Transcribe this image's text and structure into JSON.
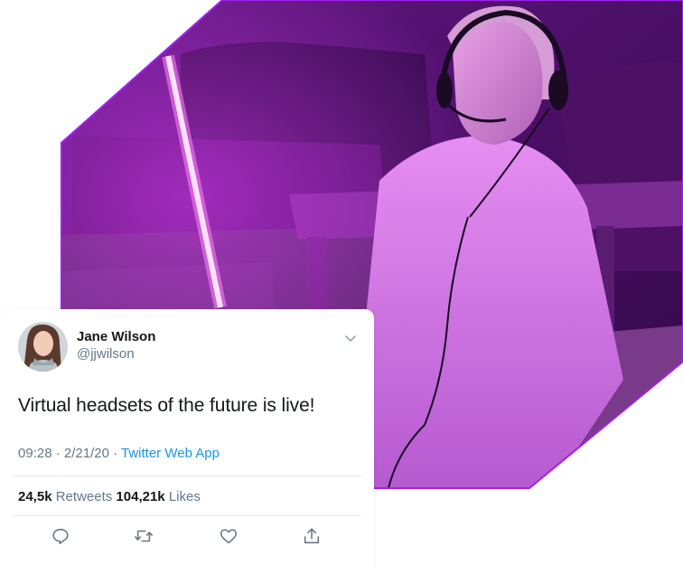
{
  "tweet": {
    "name": "Jane Wilson",
    "handle": "@jjwilson",
    "text": "Virtual headsets of the future is live!",
    "time": "09:28",
    "separator": " · ",
    "date": "2/21/20",
    "app": "Twitter Web App",
    "retweets_count": "24,5k",
    "retweets_label": " Retweets",
    "likes_count": "104,21k",
    "likes_label": " Likes"
  },
  "icons": {
    "caret": "chevron-down-icon",
    "reply": "reply-icon",
    "retweet": "retweet-icon",
    "like": "heart-icon",
    "share": "share-icon"
  },
  "colors": {
    "frame_accent": "#a020f0",
    "photo_base": "#3b0a4f",
    "neon": "#ff5cf0",
    "link": "#1b95e0",
    "muted": "#657786"
  }
}
